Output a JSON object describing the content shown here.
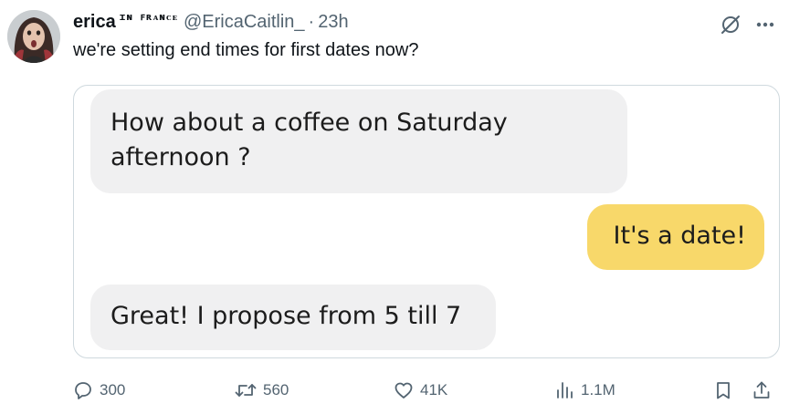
{
  "tweet": {
    "author": {
      "display_name": "erica",
      "display_name_suffix": "ɪɴ ꜰʀᴀɴᴄᴇ",
      "handle": "@EricaCaitlin_",
      "separator": "·",
      "timestamp": "23h"
    },
    "text": "we're setting end times for first dates now?",
    "media": {
      "messages": [
        {
          "side": "left",
          "text_line1": "How about a coffee on Saturday",
          "text_line2": "afternoon ?",
          "color": "#f0f0f1"
        },
        {
          "side": "right",
          "text": "It's a date!",
          "color": "#f8d86a"
        },
        {
          "side": "left",
          "text": "Great! I propose from 5 till 7",
          "color": "#f0f0f1"
        }
      ]
    },
    "actions": {
      "replies": "300",
      "reposts": "560",
      "likes": "41K",
      "views": "1.1M"
    },
    "icons": {
      "grok": "slashed-circle-icon",
      "more": "more-icon",
      "reply": "reply-icon",
      "repost": "repost-icon",
      "like": "heart-icon",
      "views": "views-icon",
      "bookmark": "bookmark-icon",
      "share": "share-icon"
    }
  }
}
